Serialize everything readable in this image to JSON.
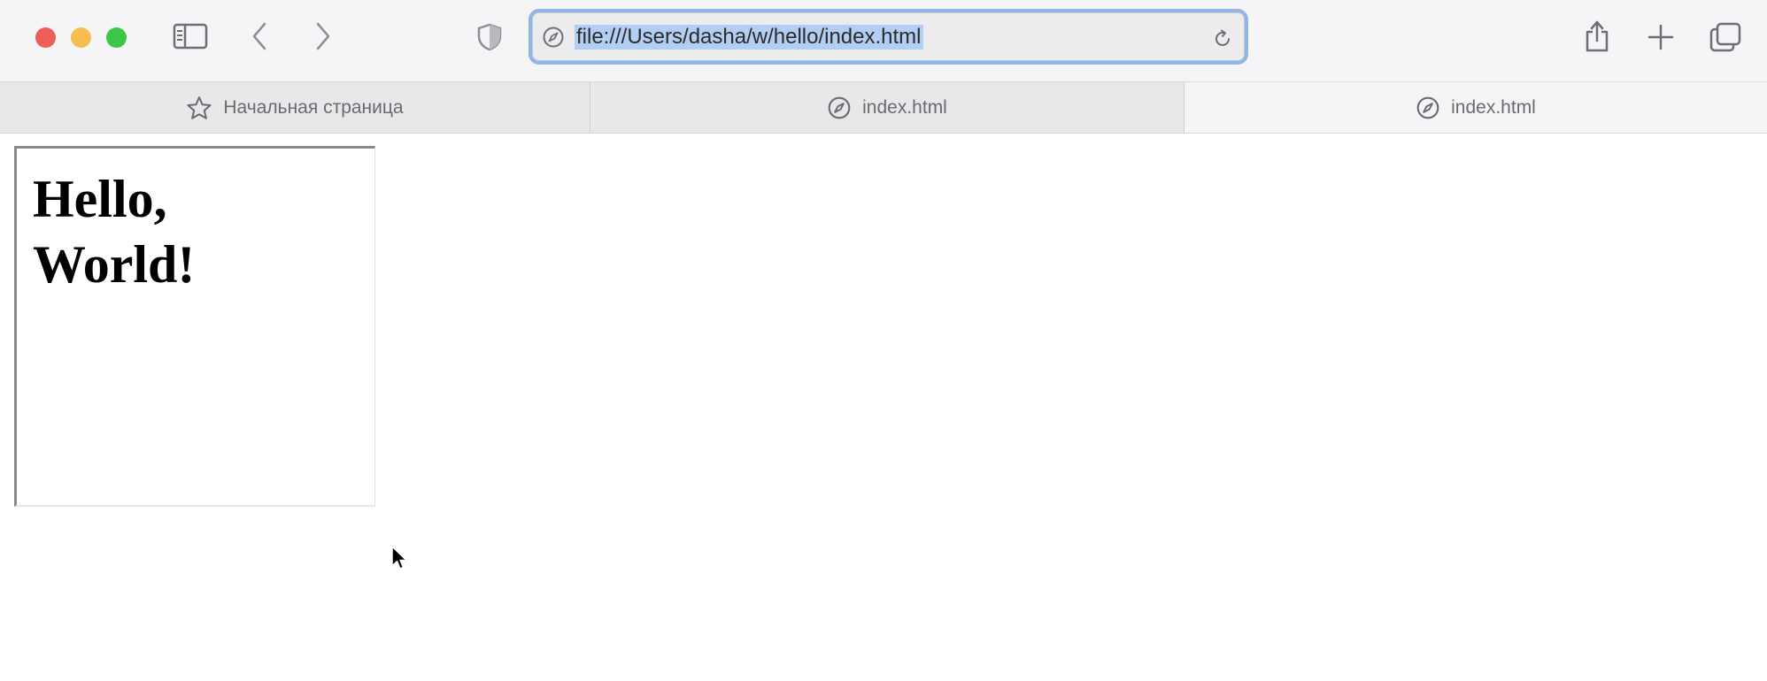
{
  "window": {
    "controls": [
      "close",
      "minimize",
      "zoom"
    ],
    "toolbar_icons": [
      "sidebar-icon",
      "back-icon",
      "forward-icon",
      "shield-icon",
      "share-icon",
      "plus-icon",
      "tabs-overview-icon"
    ]
  },
  "address_bar": {
    "url": "file:///Users/dasha/w/hello/index.html",
    "selected": true,
    "icons": [
      "compass-icon",
      "reload-icon"
    ]
  },
  "tabs": [
    {
      "label": "Начальная страница",
      "icon": "star-icon",
      "active": false
    },
    {
      "label": "index.html",
      "icon": "compass-icon",
      "active": false
    },
    {
      "label": "index.html",
      "icon": "compass-icon",
      "active": true
    }
  ],
  "page": {
    "heading_line1": "Hello,",
    "heading_line2": "World!"
  },
  "colors": {
    "accent_focus": "#8fb5ea",
    "selection": "#b2cff3",
    "close": "#ee5e57",
    "minimize": "#f6be4f",
    "zoom": "#3bc64a"
  }
}
